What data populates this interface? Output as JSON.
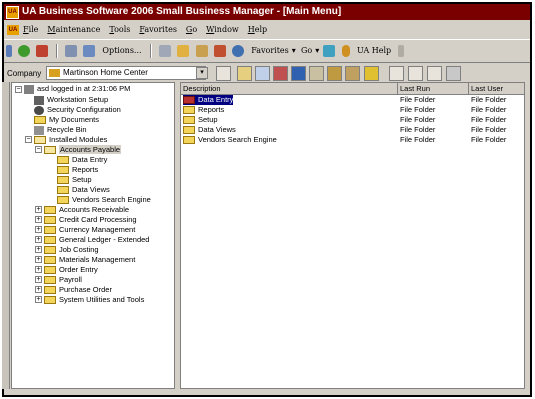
{
  "window": {
    "title": "UA Business Software 2006 Small Business Manager - [Main Menu]",
    "app_icon": "UA"
  },
  "menubar": {
    "items": [
      "File",
      "Maintenance",
      "Tools",
      "Favorites",
      "Go",
      "Window",
      "Help"
    ]
  },
  "toolbar1": {
    "options": "Options...",
    "favorites": "Favorites",
    "go": "Go",
    "help": "UA Help"
  },
  "toolbar2": {
    "company_label": "Company",
    "company_value": "Martinson Home Center"
  },
  "tree": {
    "root": "asd logged in at 2:31:06 PM",
    "items": [
      {
        "label": "Workstation Setup"
      },
      {
        "label": "Security Configuration"
      },
      {
        "label": "My Documents"
      },
      {
        "label": "Recycle Bin"
      },
      {
        "label": "Installed Modules"
      },
      {
        "label": "Accounts Payable"
      },
      {
        "label": "Data Entry"
      },
      {
        "label": "Reports"
      },
      {
        "label": "Setup"
      },
      {
        "label": "Data Views"
      },
      {
        "label": "Vendors Search Engine"
      },
      {
        "label": "Accounts Receivable"
      },
      {
        "label": "Credit Card Processing"
      },
      {
        "label": "Currency Management"
      },
      {
        "label": "General Ledger - Extended"
      },
      {
        "label": "Job Costing"
      },
      {
        "label": "Materials Management"
      },
      {
        "label": "Order Entry"
      },
      {
        "label": "Payroll"
      },
      {
        "label": "Purchase Order"
      },
      {
        "label": "System Utilities and Tools"
      }
    ]
  },
  "list": {
    "columns": [
      "Description",
      "Last Run",
      "Last User"
    ],
    "rows": [
      {
        "description": "Data Entry",
        "last_run": "File Folder",
        "last_user": "File Folder"
      },
      {
        "description": "Reports",
        "last_run": "File Folder",
        "last_user": "File Folder"
      },
      {
        "description": "Setup",
        "last_run": "File Folder",
        "last_user": "File Folder"
      },
      {
        "description": "Data Views",
        "last_run": "File Folder",
        "last_user": "File Folder"
      },
      {
        "description": "Vendors Search Engine",
        "last_run": "File Folder",
        "last_user": "File Folder"
      }
    ]
  },
  "colors": {
    "title_bar": "#7a0000",
    "selection": "#000080",
    "folder": "#f2d55a"
  }
}
